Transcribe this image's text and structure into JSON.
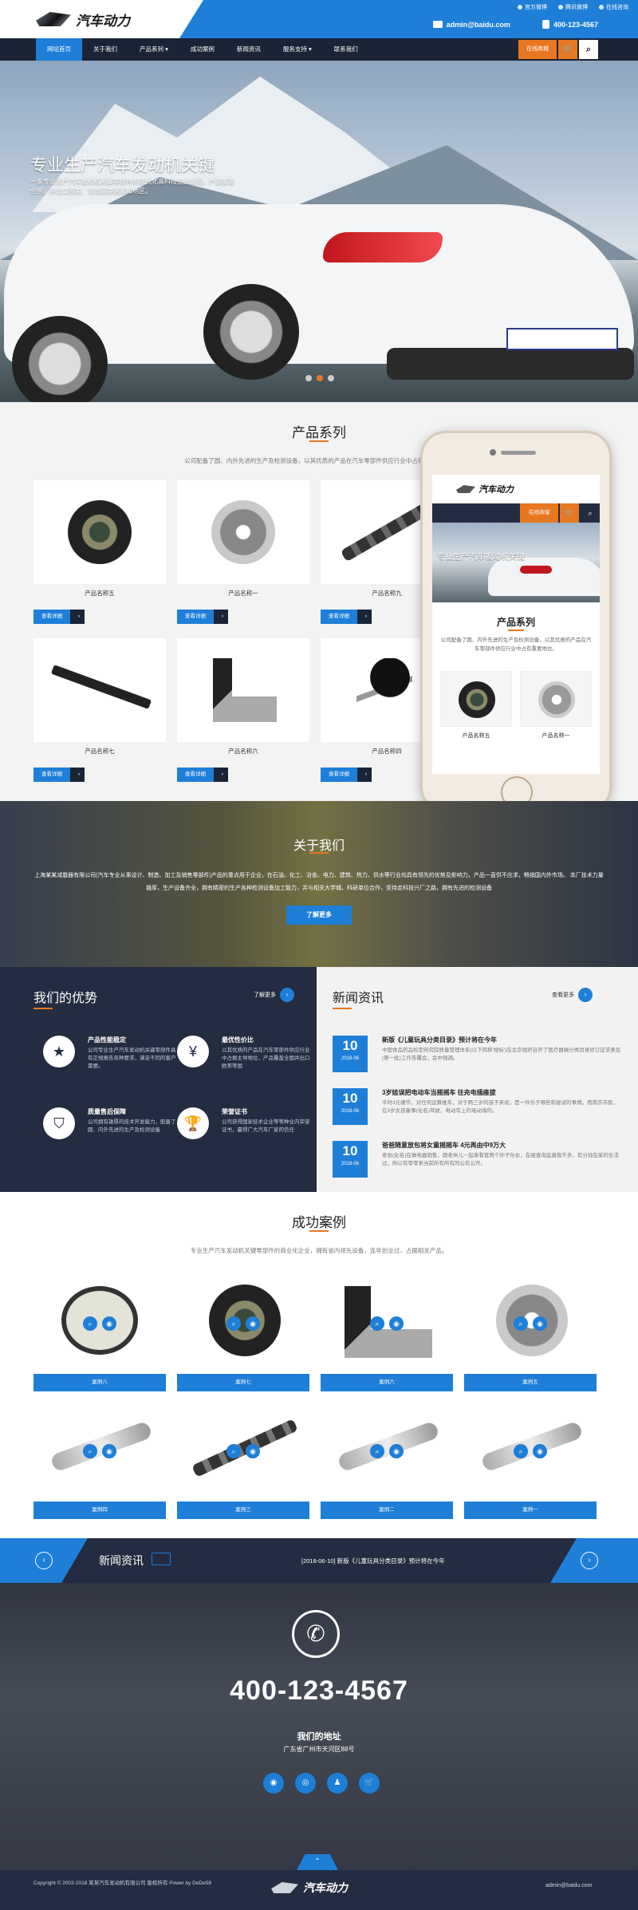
{
  "header": {
    "logo_text": "汽车动力",
    "top_links": [
      "官方微博",
      "腾讯微博",
      "在线咨询"
    ],
    "email": "admin@baidu.com",
    "phone": "400-123-4567",
    "nav": [
      "网站首页",
      "关于我们",
      "产品系列 ▾",
      "成功案例",
      "新闻资讯",
      "服务支持 ▾",
      "联系我们"
    ],
    "shop_label": "在线商城",
    "cart_icon": "cart-icon",
    "search_icon": "search-icon"
  },
  "hero": {
    "title": "专业生产汽车发动机关键",
    "subtitle": "一家专业生产汽车发动机关键零部件的现代化高科技企业公司，产品覆盖全国，并出口欧美、东南亚等国家和地区。"
  },
  "products": {
    "title": "产品系列",
    "desc": "公司配备了圆、内外先进的生产及检测设备，以其优质的产品在汽车零部件供应行业中占有重要地位。",
    "more_label": "查看详细",
    "items": [
      "产品名称五",
      "产品名称一",
      "产品名称九",
      "产品名称七",
      "产品名称六",
      "产品名称四"
    ]
  },
  "phone_mock": {
    "shop_label": "在线商城",
    "hero_title": "专业生产汽车发动机关键",
    "section_title": "产品系列",
    "section_desc": "公司配备了圆、内外先进的生产及检测设备，以其优质的产品在汽车零部件供应行业中占有重要地位。",
    "items": [
      "产品名称五",
      "产品名称一"
    ]
  },
  "about": {
    "title": "关于我们",
    "text": "上海某某减震器有限公司(汽车专业从事设计、制造、加工及销售零部件)产品的重点用于企业，在石油、化工、冶金、电力、建筑、热力、供水等行业均具有领先的优势及影响力。产品一直供不应求，畅销国内外市场。 本厂技术力量雄厚，生产设备齐全，拥有精密的生产各种检测设备加工能力，并与相关大学城、科研单位合作，坚持走科技兴厂之路，拥有先进的检测设备",
    "button": "了解更多"
  },
  "advantages": {
    "title": "我们的优势",
    "more": "了解更多",
    "items": [
      {
        "icon": "star-icon",
        "title": "产品性能稳定",
        "desc": "公司专业生产汽车发动机关键零部件具有正规报告各种要求，满足不同的客户需要。"
      },
      {
        "icon": "money-icon",
        "title": "最优性价比",
        "desc": "以其优质的产品在汽车零部件供应行业中占据主导地位，产品覆盖全国并出口欧美等国"
      },
      {
        "icon": "shield-icon",
        "title": "质量售后保障",
        "desc": "公司拥有雄厚的技术开发能力，配备了圆、内外先进的生产及检测设备"
      },
      {
        "icon": "trophy-icon",
        "title": "荣誉证书",
        "desc": "公司获得国家技术企业等等种业内荣誉证书，赢得广大汽车厂家的信任"
      }
    ]
  },
  "news": {
    "title": "新闻资讯",
    "more": "查看更多",
    "items": [
      {
        "day": "10",
        "ym": "2018-06",
        "title": "新版《儿童玩具分类目录》预计将在今年",
        "summary": "中国食品药品检定研究院质量管理体系(以下简称'规标')在北京组织召开了医疗器械分类目录修订征求意见(第一批)工作答覆会，会中强调。"
      },
      {
        "day": "10",
        "ym": "2018-06",
        "title": "3岁娃误把电动车当摇摇车 往充电插座拔",
        "summary": "平时3元硬币，对任何运算推车，对于两三岁的孩子来说，是一件乐于哪些和尝试的事情。而南京市民，在3岁女孩童事(化名)驾驶，电动车上的电动填的。"
      },
      {
        "day": "10",
        "ym": "2018-06",
        "title": "爸爸随意放包将女童摇摇车 4元再由中9万大",
        "summary": "老张(化名)在做电器销售，跟老伴儿一起来看管两个孙子孙女，在被查询监督我不多，有分钱在家的生活过，所以有零零来当前所有所有的公有公开。"
      }
    ]
  },
  "cases": {
    "title": "成功案例",
    "desc": "专业生产汽车发动机关键零部件的商业化企业，拥有省内领先设备，连年创业过，占据相关产品。",
    "items": [
      "案例八",
      "案例七",
      "案例六",
      "案例五",
      "案例四",
      "案例三",
      "案例二",
      "案例一"
    ]
  },
  "ticker": {
    "label": "新闻资讯",
    "headline": "[2018-06-10] 新版《儿童玩具分类目录》预计将在今年"
  },
  "footer": {
    "phone": "400-123-4567",
    "address_title": "我们的地址",
    "address": "广东省广州市天河区88号",
    "social_icons": [
      "weibo-icon",
      "wechat-icon",
      "qq-icon",
      "cart-icon"
    ],
    "copyright": "Copyright © 2002-2018 某某汽车发动机有限公司 版权所有 Power by DeDe58",
    "logo_text": "汽车动力",
    "email": "admin@baidu.com"
  },
  "colors": {
    "accent": "#1d7fd8",
    "orange": "#e87722",
    "navy": "#232c40"
  }
}
